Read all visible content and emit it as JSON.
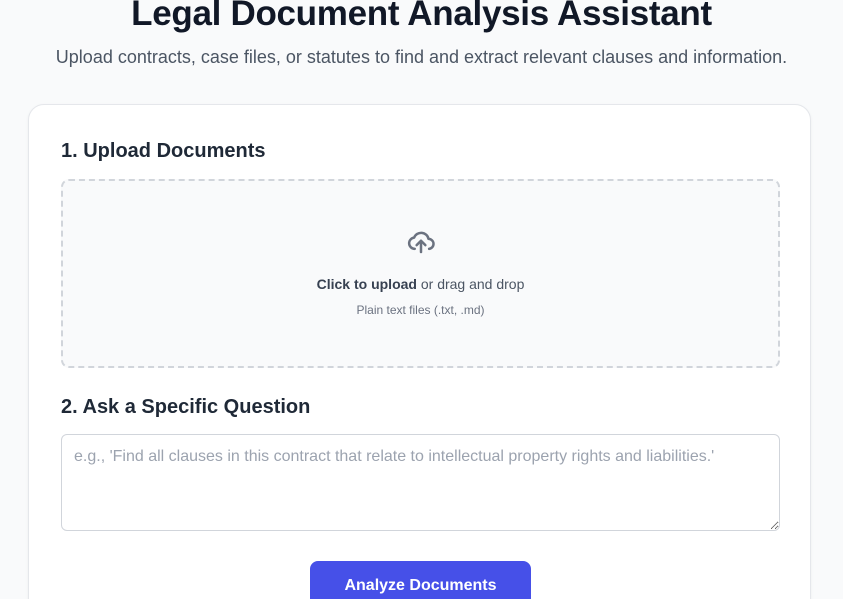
{
  "header": {
    "title": "Legal Document Analysis Assistant",
    "subtitle": "Upload contracts, case files, or statutes to find and extract relevant clauses and information."
  },
  "upload_section": {
    "heading": "1. Upload Documents",
    "icon": "cloud-upload-icon",
    "click_label": "Click to upload",
    "drag_label": " or drag and drop",
    "hint": "Plain text files (.txt, .md)"
  },
  "question_section": {
    "heading": "2. Ask a Specific Question",
    "value": "",
    "placeholder": "e.g., 'Find all clauses in this contract that relate to intellectual property rights and liabilities.'"
  },
  "actions": {
    "analyze_label": "Analyze Documents"
  },
  "colors": {
    "accent": "#4650e8",
    "background": "#f9fafb",
    "card": "#ffffff",
    "border": "#d1d5db"
  }
}
